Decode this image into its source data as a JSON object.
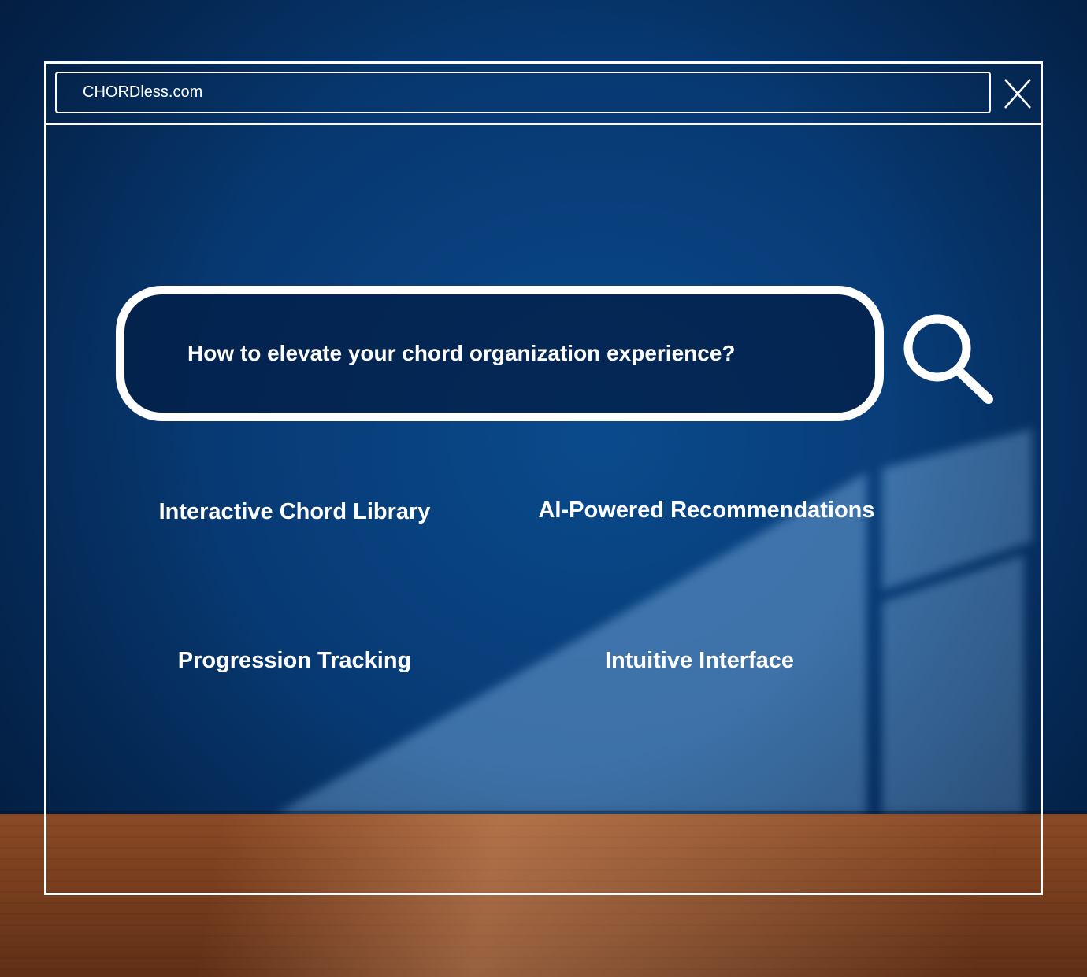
{
  "browser": {
    "address": "CHORDless.com",
    "close_icon": "close-icon"
  },
  "search": {
    "query": "How to elevate your chord organization experience?",
    "icon": "search-icon"
  },
  "features": [
    {
      "label": "Interactive Chord Library"
    },
    {
      "label": "AI-Powered Recommendations"
    },
    {
      "label": "Progression Tracking"
    },
    {
      "label": "Intuitive Interface"
    }
  ],
  "colors": {
    "wall": "#073a74",
    "floor": "#7a3f1f",
    "outline": "#ffffff"
  }
}
